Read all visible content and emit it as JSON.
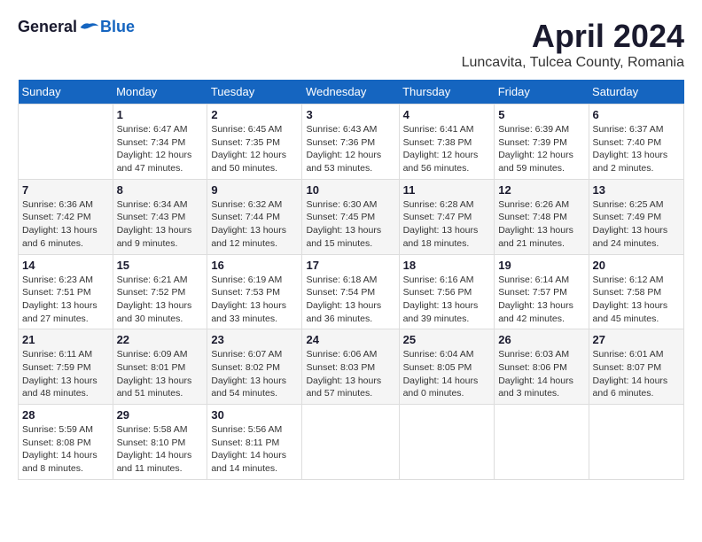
{
  "header": {
    "logo_general": "General",
    "logo_blue": "Blue",
    "title": "April 2024",
    "location": "Luncavita, Tulcea County, Romania"
  },
  "calendar": {
    "days_of_week": [
      "Sunday",
      "Monday",
      "Tuesday",
      "Wednesday",
      "Thursday",
      "Friday",
      "Saturday"
    ],
    "weeks": [
      [
        {
          "day": "",
          "info": ""
        },
        {
          "day": "1",
          "info": "Sunrise: 6:47 AM\nSunset: 7:34 PM\nDaylight: 12 hours\nand 47 minutes."
        },
        {
          "day": "2",
          "info": "Sunrise: 6:45 AM\nSunset: 7:35 PM\nDaylight: 12 hours\nand 50 minutes."
        },
        {
          "day": "3",
          "info": "Sunrise: 6:43 AM\nSunset: 7:36 PM\nDaylight: 12 hours\nand 53 minutes."
        },
        {
          "day": "4",
          "info": "Sunrise: 6:41 AM\nSunset: 7:38 PM\nDaylight: 12 hours\nand 56 minutes."
        },
        {
          "day": "5",
          "info": "Sunrise: 6:39 AM\nSunset: 7:39 PM\nDaylight: 12 hours\nand 59 minutes."
        },
        {
          "day": "6",
          "info": "Sunrise: 6:37 AM\nSunset: 7:40 PM\nDaylight: 13 hours\nand 2 minutes."
        }
      ],
      [
        {
          "day": "7",
          "info": "Sunrise: 6:36 AM\nSunset: 7:42 PM\nDaylight: 13 hours\nand 6 minutes."
        },
        {
          "day": "8",
          "info": "Sunrise: 6:34 AM\nSunset: 7:43 PM\nDaylight: 13 hours\nand 9 minutes."
        },
        {
          "day": "9",
          "info": "Sunrise: 6:32 AM\nSunset: 7:44 PM\nDaylight: 13 hours\nand 12 minutes."
        },
        {
          "day": "10",
          "info": "Sunrise: 6:30 AM\nSunset: 7:45 PM\nDaylight: 13 hours\nand 15 minutes."
        },
        {
          "day": "11",
          "info": "Sunrise: 6:28 AM\nSunset: 7:47 PM\nDaylight: 13 hours\nand 18 minutes."
        },
        {
          "day": "12",
          "info": "Sunrise: 6:26 AM\nSunset: 7:48 PM\nDaylight: 13 hours\nand 21 minutes."
        },
        {
          "day": "13",
          "info": "Sunrise: 6:25 AM\nSunset: 7:49 PM\nDaylight: 13 hours\nand 24 minutes."
        }
      ],
      [
        {
          "day": "14",
          "info": "Sunrise: 6:23 AM\nSunset: 7:51 PM\nDaylight: 13 hours\nand 27 minutes."
        },
        {
          "day": "15",
          "info": "Sunrise: 6:21 AM\nSunset: 7:52 PM\nDaylight: 13 hours\nand 30 minutes."
        },
        {
          "day": "16",
          "info": "Sunrise: 6:19 AM\nSunset: 7:53 PM\nDaylight: 13 hours\nand 33 minutes."
        },
        {
          "day": "17",
          "info": "Sunrise: 6:18 AM\nSunset: 7:54 PM\nDaylight: 13 hours\nand 36 minutes."
        },
        {
          "day": "18",
          "info": "Sunrise: 6:16 AM\nSunset: 7:56 PM\nDaylight: 13 hours\nand 39 minutes."
        },
        {
          "day": "19",
          "info": "Sunrise: 6:14 AM\nSunset: 7:57 PM\nDaylight: 13 hours\nand 42 minutes."
        },
        {
          "day": "20",
          "info": "Sunrise: 6:12 AM\nSunset: 7:58 PM\nDaylight: 13 hours\nand 45 minutes."
        }
      ],
      [
        {
          "day": "21",
          "info": "Sunrise: 6:11 AM\nSunset: 7:59 PM\nDaylight: 13 hours\nand 48 minutes."
        },
        {
          "day": "22",
          "info": "Sunrise: 6:09 AM\nSunset: 8:01 PM\nDaylight: 13 hours\nand 51 minutes."
        },
        {
          "day": "23",
          "info": "Sunrise: 6:07 AM\nSunset: 8:02 PM\nDaylight: 13 hours\nand 54 minutes."
        },
        {
          "day": "24",
          "info": "Sunrise: 6:06 AM\nSunset: 8:03 PM\nDaylight: 13 hours\nand 57 minutes."
        },
        {
          "day": "25",
          "info": "Sunrise: 6:04 AM\nSunset: 8:05 PM\nDaylight: 14 hours\nand 0 minutes."
        },
        {
          "day": "26",
          "info": "Sunrise: 6:03 AM\nSunset: 8:06 PM\nDaylight: 14 hours\nand 3 minutes."
        },
        {
          "day": "27",
          "info": "Sunrise: 6:01 AM\nSunset: 8:07 PM\nDaylight: 14 hours\nand 6 minutes."
        }
      ],
      [
        {
          "day": "28",
          "info": "Sunrise: 5:59 AM\nSunset: 8:08 PM\nDaylight: 14 hours\nand 8 minutes."
        },
        {
          "day": "29",
          "info": "Sunrise: 5:58 AM\nSunset: 8:10 PM\nDaylight: 14 hours\nand 11 minutes."
        },
        {
          "day": "30",
          "info": "Sunrise: 5:56 AM\nSunset: 8:11 PM\nDaylight: 14 hours\nand 14 minutes."
        },
        {
          "day": "",
          "info": ""
        },
        {
          "day": "",
          "info": ""
        },
        {
          "day": "",
          "info": ""
        },
        {
          "day": "",
          "info": ""
        }
      ]
    ]
  }
}
